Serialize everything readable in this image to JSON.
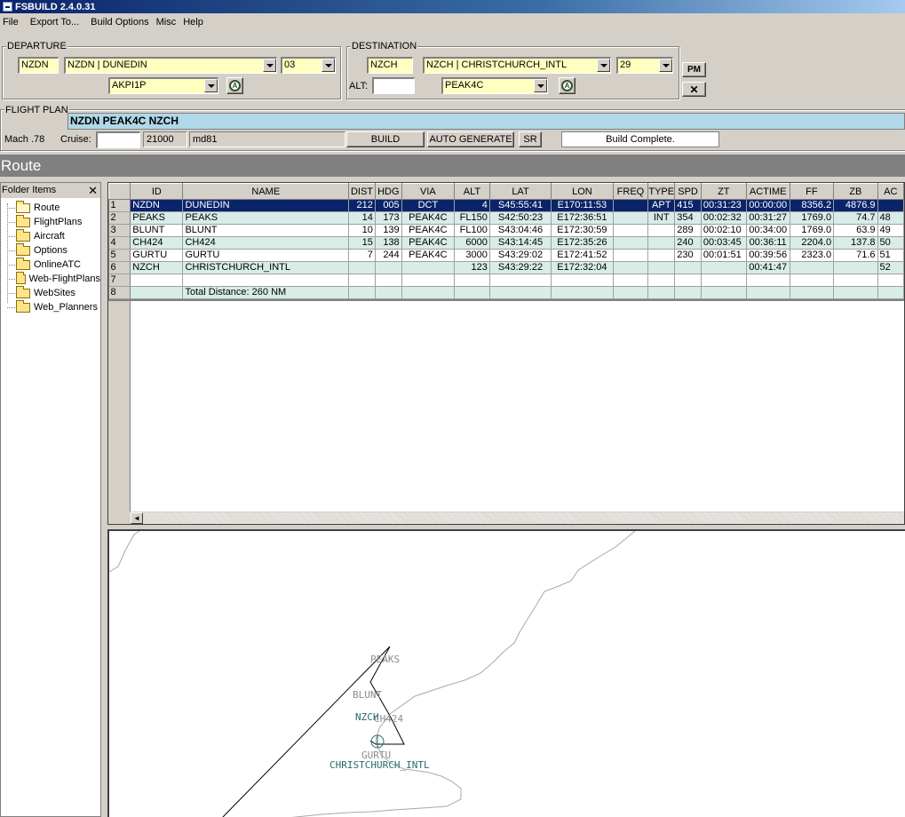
{
  "window": {
    "title": "FSBUILD 2.4.0.31"
  },
  "menu": [
    "File",
    "Export To...",
    "Build Options",
    "Misc",
    "Help"
  ],
  "departure": {
    "label": "DEPARTURE",
    "icao": "NZDN",
    "airport": "NZDN | DUNEDIN",
    "runway": "03",
    "procedure": "AKPI1P"
  },
  "destination": {
    "label": "DESTINATION",
    "icao": "NZCH",
    "airport": "NZCH | CHRISTCHURCH_INTL",
    "runway": "29",
    "alt_label": "ALT:",
    "alt_value": "",
    "procedure": "PEAK4C"
  },
  "side_buttons": {
    "pm": "PM",
    "close": "✕"
  },
  "flight_plan": {
    "label": "FLIGHT PLAN",
    "route": "NZDN PEAK4C NZCH",
    "mach": "Mach .78",
    "cruise_label": "Cruise:",
    "cruise_value": "",
    "altitude": "21000",
    "aircraft": "md81",
    "build_label": "BUILD",
    "auto_label": "AUTO GENERATE",
    "sr_label": "SR",
    "status": "Build Complete."
  },
  "route_header": "Route",
  "folder": {
    "title": "Folder Items",
    "close": "✕",
    "items": [
      "Route",
      "FlightPlans",
      "Aircraft",
      "Options",
      "OnlineATC",
      "Web-FlightPlans",
      "WebSites",
      "Web_Planners"
    ]
  },
  "grid": {
    "columns": [
      "",
      "ID",
      "NAME",
      "DIST",
      "HDG",
      "VIA",
      "ALT",
      "LAT",
      "LON",
      "FREQ",
      "TYPE",
      "SPD",
      "ZT",
      "ACTIME",
      "FF",
      "ZB",
      "AC"
    ],
    "rows": [
      [
        "1",
        "NZDN",
        "DUNEDIN",
        "212",
        "005",
        "DCT",
        "4",
        "S45:55:41",
        "E170:11:53",
        "",
        "APT",
        "415",
        "00:31:23",
        "00:00:00",
        "8356.2",
        "4876.9",
        ""
      ],
      [
        "2",
        "PEAKS",
        "PEAKS",
        "14",
        "173",
        "PEAK4C",
        "FL150",
        "S42:50:23",
        "E172:36:51",
        "",
        "INT",
        "354",
        "00:02:32",
        "00:31:27",
        "1769.0",
        "74.7",
        "48"
      ],
      [
        "3",
        "BLUNT",
        "BLUNT",
        "10",
        "139",
        "PEAK4C",
        "FL100",
        "S43:04:46",
        "E172:30:59",
        "",
        "",
        "289",
        "00:02:10",
        "00:34:00",
        "1769.0",
        "63.9",
        "49"
      ],
      [
        "4",
        "CH424",
        "CH424",
        "15",
        "138",
        "PEAK4C",
        "6000",
        "S43:14:45",
        "E172:35:26",
        "",
        "",
        "240",
        "00:03:45",
        "00:36:11",
        "2204.0",
        "137.8",
        "50"
      ],
      [
        "5",
        "GURTU",
        "GURTU",
        "7",
        "244",
        "PEAK4C",
        "3000",
        "S43:29:02",
        "E172:41:52",
        "",
        "",
        "230",
        "00:01:51",
        "00:39:56",
        "2323.0",
        "71.6",
        "51"
      ],
      [
        "6",
        "NZCH",
        "CHRISTCHURCH_INTL",
        "",
        "",
        "",
        "123",
        "S43:29:22",
        "E172:32:04",
        "",
        "",
        "",
        "",
        "00:41:47",
        "",
        "",
        "52"
      ],
      [
        "7",
        "",
        "",
        "",
        "",
        "",
        "",
        "",
        "",
        "",
        "",
        "",
        "",
        "",
        "",
        "",
        ""
      ],
      [
        "8",
        "",
        "Total Distance: 260 NM",
        "",
        "",
        "",
        "",
        "",
        "",
        "",
        "",
        "",
        "",
        "",
        "",
        "",
        ""
      ]
    ]
  },
  "scroll": {
    "left_arrow": "◄"
  },
  "map": {
    "labels": {
      "peaks": "PEAKS",
      "blunt": "BLUNT",
      "ch424": "CH424",
      "nzch_code": "NZCH",
      "gurtu": "GURTU",
      "christchurch": "CHRISTCHURCH_INTL"
    },
    "colors": {
      "coast": "#a8a8a8",
      "route": "#000000",
      "label": "#8c8c8c",
      "airport": "#2a6b6b"
    }
  }
}
